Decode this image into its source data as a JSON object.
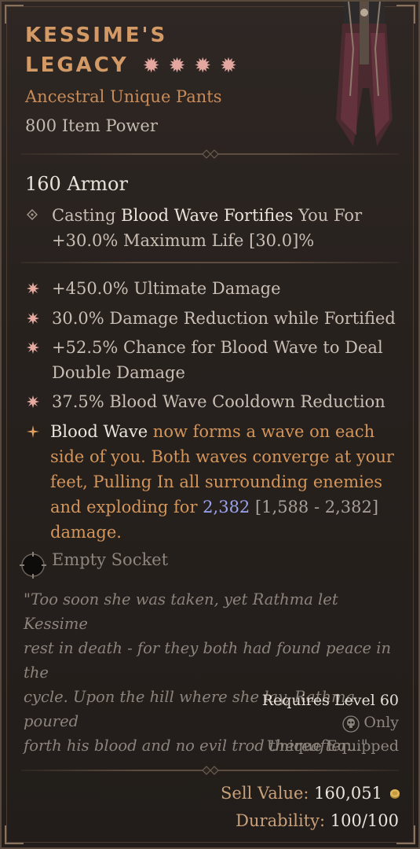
{
  "item": {
    "name_line1": "Kessime's",
    "name_line2": "Legacy",
    "stars": [
      "✹",
      "✹",
      "✹",
      "✹"
    ],
    "type": "Ancestral Unique Pants",
    "item_power": "800 Item Power",
    "armor": "160 Armor"
  },
  "implicit": {
    "prefix": "Casting ",
    "skill": "Blood Wave",
    "mid": " Fortifies",
    "suffix": " You For",
    "line2": "+30.0% Maximum Life [30.0]%"
  },
  "affixes": [
    {
      "text1": "+450.0% Ultimate Damage"
    },
    {
      "text1": "30.0% Damage Reduction while Fortified"
    },
    {
      "text1": "+52.5% Chance for Blood Wave to Deal",
      "text2": "Double Damage"
    },
    {
      "text1": "37.5% Blood Wave Cooldown Reduction"
    }
  ],
  "unique_power": {
    "skill": "Blood Wave",
    "line1_rest": " now forms a wave on each",
    "line2": "side of you. Both waves converge at your",
    "line3": "feet, Pulling In all surrounding enemies",
    "line4_pre": "and exploding for ",
    "value": "2,382",
    "range": " [1,588 - 2,382]",
    "line5": "damage."
  },
  "socket": {
    "label": "Empty Socket"
  },
  "flavor": {
    "line1": "\"Too soon she was taken, yet Rathma let Kessime",
    "line2": "rest in death - for they both had found peace in the",
    "line3": "cycle. Upon the hill where she lay, Rathma poured",
    "line4": "forth his blood and no evil trod thereafter...\""
  },
  "requirements": {
    "level": "Requires Level 60",
    "class_only": "Only",
    "unique_equipped": "Unique Equipped"
  },
  "footer": {
    "sell_label": "Sell Value: ",
    "sell_value": "160,051",
    "durability_label": "Durability: ",
    "durability_value": "100/100"
  },
  "colors": {
    "title": "#d49a66",
    "stars": "#e3a7a0",
    "unique_power_text": "#d4955b",
    "damage_value": "#9aa3ee",
    "background": "#27211e"
  },
  "icons": {
    "implicit_bullet": "diamond-bullet-icon",
    "affix_bullet": "starburst-bullet-icon",
    "unique_bullet": "unique-star-bullet-icon",
    "socket": "empty-socket-icon",
    "class": "necromancer-skull-icon",
    "gold": "gold-coin-icon"
  }
}
